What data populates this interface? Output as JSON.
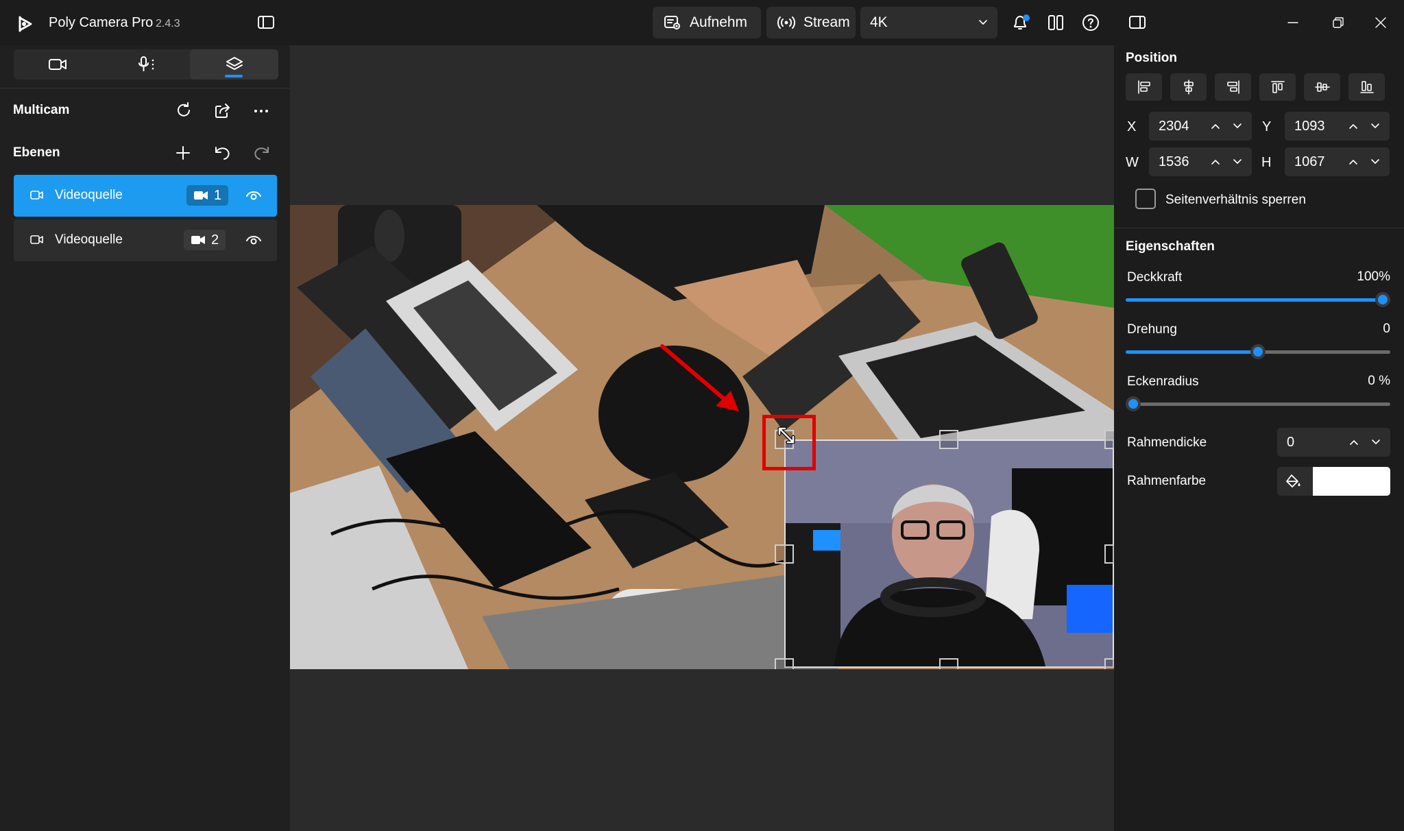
{
  "app": {
    "title": "Poly Camera Pro",
    "version": "2.4.3"
  },
  "toolbar": {
    "record_label": "Aufnehm",
    "stream_label": "Stream",
    "resolution": "4K"
  },
  "left_panel": {
    "tabs": [
      "camera-icon",
      "microphone-icon",
      "layers-icon"
    ],
    "active_tab": "layers",
    "multicam_title": "Multicam",
    "layers_title": "Ebenen",
    "layers": [
      {
        "label": "Videoquelle",
        "camera_number": "1",
        "selected": true
      },
      {
        "label": "Videoquelle",
        "camera_number": "2",
        "selected": false
      }
    ]
  },
  "properties": {
    "position_title": "Position",
    "x_label": "X",
    "x_value": "2304",
    "y_label": "Y",
    "y_value": "1093",
    "w_label": "W",
    "w_value": "1536",
    "h_label": "H",
    "h_value": "1067",
    "lock_aspect_label": "Seitenverhältnis sperren",
    "lock_aspect_checked": false,
    "section_title": "Eigenschaften",
    "opacity_label": "Deckkraft",
    "opacity_value": "100%",
    "opacity_fraction": 1.0,
    "rotation_label": "Drehung",
    "rotation_value": "0",
    "rotation_fraction": 0.5,
    "corner_label": "Eckenradius",
    "corner_value": "0 %",
    "corner_fraction": 0.0,
    "border_width_label": "Rahmendicke",
    "border_width_value": "0",
    "border_color_label": "Rahmenfarbe",
    "border_color": "#ffffff"
  },
  "colors": {
    "accent": "#1e90ff",
    "selected_row": "#1d9bf0",
    "annotation": "#e00000"
  }
}
